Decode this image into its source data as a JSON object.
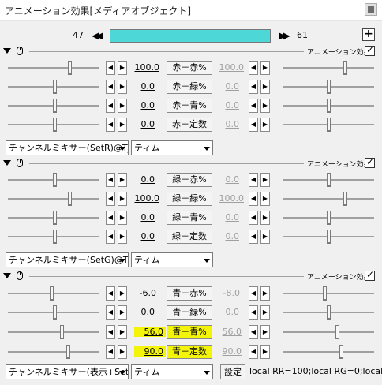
{
  "window": {
    "title": "アニメーション効果[メディアオブジェクト]"
  },
  "frame": {
    "start": "47",
    "end": "61",
    "prev_icon": "rewind-icon",
    "next_icon": "fast-forward-icon",
    "seek_fraction": 0.42
  },
  "colors": {
    "seek": "#4dd7d7",
    "highlight": "#f4f40a"
  },
  "groups": [
    {
      "name": "アニメーション効果",
      "params": [
        {
          "label": "赤－赤%",
          "left": "100.0",
          "right": "100.0",
          "highlight": false
        },
        {
          "label": "赤－緑%",
          "left": "0.0",
          "right": "0.0",
          "highlight": false
        },
        {
          "label": "赤－青%",
          "left": "0.0",
          "right": "0.0",
          "highlight": false
        },
        {
          "label": "赤－定数",
          "left": "0.0",
          "right": "0.0",
          "highlight": false
        }
      ],
      "script": "チャンネルミキサー(SetR)@T_",
      "easing": "ティム"
    },
    {
      "name": "アニメーション効果",
      "params": [
        {
          "label": "緑－赤%",
          "left": "0.0",
          "right": "0.0",
          "highlight": false
        },
        {
          "label": "緑－緑%",
          "left": "100.0",
          "right": "100.0",
          "highlight": false
        },
        {
          "label": "緑－青%",
          "left": "0.0",
          "right": "0.0",
          "highlight": false
        },
        {
          "label": "緑－定数",
          "left": "0.0",
          "right": "0.0",
          "highlight": false
        }
      ],
      "script": "チャンネルミキサー(SetG)@T_",
      "easing": "ティム"
    },
    {
      "name": "アニメーション効果",
      "params": [
        {
          "label": "青－赤%",
          "left": "-6.0",
          "right": "-8.0",
          "highlight": false
        },
        {
          "label": "青－緑%",
          "left": "0.0",
          "right": "0.0",
          "highlight": false
        },
        {
          "label": "青－青%",
          "left": "56.0",
          "right": "56.0",
          "highlight": true
        },
        {
          "label": "青－定数",
          "left": "90.0",
          "right": "90.0",
          "highlight": true
        }
      ],
      "script": "チャンネルミキサー(表示+Set",
      "easing": "ティム",
      "settings_label": "設定",
      "script_text": "local RR=100;local RG=0;local R"
    }
  ]
}
